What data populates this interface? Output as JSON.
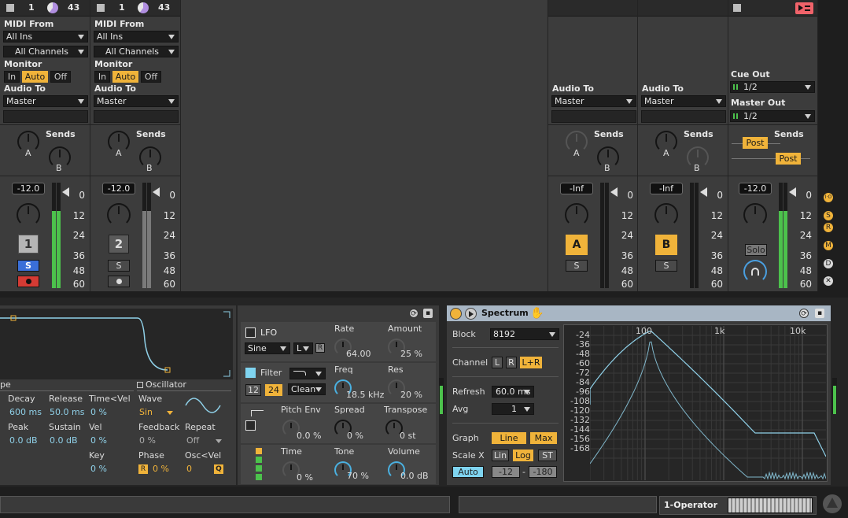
{
  "tracks": [
    {
      "num_a": "1",
      "num_b": "43",
      "midi_from_label": "MIDI From",
      "midi_from": "All Ins",
      "channel": "All Channels",
      "monitor_label": "Monitor",
      "mon_in": "In",
      "mon_auto": "Auto",
      "mon_off": "Off",
      "audio_to_label": "Audio To",
      "audio_to": "Master",
      "sends_label": "Sends",
      "send_a": "A",
      "send_b": "B",
      "volume": "-12.0",
      "track_number": "1",
      "solo": "S"
    },
    {
      "num_a": "1",
      "num_b": "43",
      "midi_from_label": "MIDI From",
      "midi_from": "All Ins",
      "channel": "All Channels",
      "monitor_label": "Monitor",
      "mon_in": "In",
      "mon_auto": "Auto",
      "mon_off": "Off",
      "audio_to_label": "Audio To",
      "audio_to": "Master",
      "sends_label": "Sends",
      "send_a": "A",
      "send_b": "B",
      "volume": "-12.0",
      "track_number": "2",
      "solo": "S"
    }
  ],
  "returns": [
    {
      "audio_to_label": "Audio To",
      "audio_to": "Master",
      "sends_label": "Sends",
      "send_a": "A",
      "send_b": "B",
      "volume": "-Inf",
      "name": "A",
      "solo": "S"
    },
    {
      "audio_to_label": "Audio To",
      "audio_to": "Master",
      "sends_label": "Sends",
      "send_a": "A",
      "send_b": "B",
      "volume": "-Inf",
      "name": "B",
      "solo": "S"
    }
  ],
  "master": {
    "cue_out_label": "Cue Out",
    "cue_out": "1/2",
    "master_out_label": "Master Out",
    "master_out": "1/2",
    "sends_label": "Sends",
    "post1": "Post",
    "post2": "Post",
    "volume": "-12.0",
    "solo": "Solo"
  },
  "meter_scale": [
    "0",
    "12",
    "24",
    "36",
    "48",
    "60"
  ],
  "side_buttons": [
    "I·O",
    "S",
    "R",
    "M",
    "D",
    "✕"
  ],
  "operator": {
    "env_label": "pe",
    "decay_label": "Decay",
    "decay": "600 ms",
    "release_label": "Release",
    "release": "50.0 ms",
    "timevel_label": "Time<Vel",
    "timevel": "0 %",
    "peak_label": "Peak",
    "peak": "0.0 dB",
    "sustain_label": "Sustain",
    "sustain": "0.0 dB",
    "vel_label": "Vel",
    "vel": "0 %",
    "key_label": "Key",
    "key": "0 %",
    "osc_label": "Oscillator",
    "wave_label": "Wave",
    "wave": "Sin",
    "feedback_label": "Feedback",
    "feedback": "0 %",
    "repeat_label": "Repeat",
    "repeat": "Off",
    "phase_label": "Phase",
    "phase_r": "R",
    "phase": "0 %",
    "oscvel_label": "Osc<Vel",
    "oscvel": "0",
    "q": "Q",
    "lfo_label": "LFO",
    "lfo_wave": "Sine",
    "lfo_range": "L",
    "lfo_r": "R",
    "rate_label": "Rate",
    "rate": "64.00",
    "amount_label": "Amount",
    "amount": "25 %",
    "filter_label": "Filter",
    "slope12": "12",
    "slope24": "24",
    "filter_mode": "Clean",
    "freq_label": "Freq",
    "freq": "18.5 kHz",
    "res_label": "Res",
    "res": "20 %",
    "pitchenv_label": "Pitch Env",
    "pitchenv": "0.0 %",
    "spread_label": "Spread",
    "spread": "0 %",
    "transpose_label": "Transpose",
    "transpose": "0 st",
    "time_label": "Time",
    "time": "0 %",
    "tone_label": "Tone",
    "tone": "70 %",
    "volume_label": "Volume",
    "volume": "0.0 dB"
  },
  "spectrum": {
    "title": "Spectrum",
    "block_label": "Block",
    "block": "8192",
    "channel_label": "Channel",
    "ch_l": "L",
    "ch_r": "R",
    "ch_lr": "L+R",
    "refresh_label": "Refresh",
    "refresh": "60.0 ms",
    "avg_label": "Avg",
    "avg": "1",
    "graph_label": "Graph",
    "line": "Line",
    "max": "Max",
    "scalex_label": "Scale X",
    "lin": "Lin",
    "log": "Log",
    "st": "ST",
    "auto": "Auto",
    "range_lo": "-12",
    "range_hi": "-180",
    "freq_ticks": [
      "100",
      "1k",
      "10k"
    ],
    "db_ticks": [
      "-24",
      "-36",
      "-48",
      "-60",
      "-72",
      "-84",
      "-96",
      "-108",
      "-120",
      "-132",
      "-144",
      "-156",
      "-168"
    ]
  },
  "footer": {
    "device_name": "1-Operator"
  }
}
